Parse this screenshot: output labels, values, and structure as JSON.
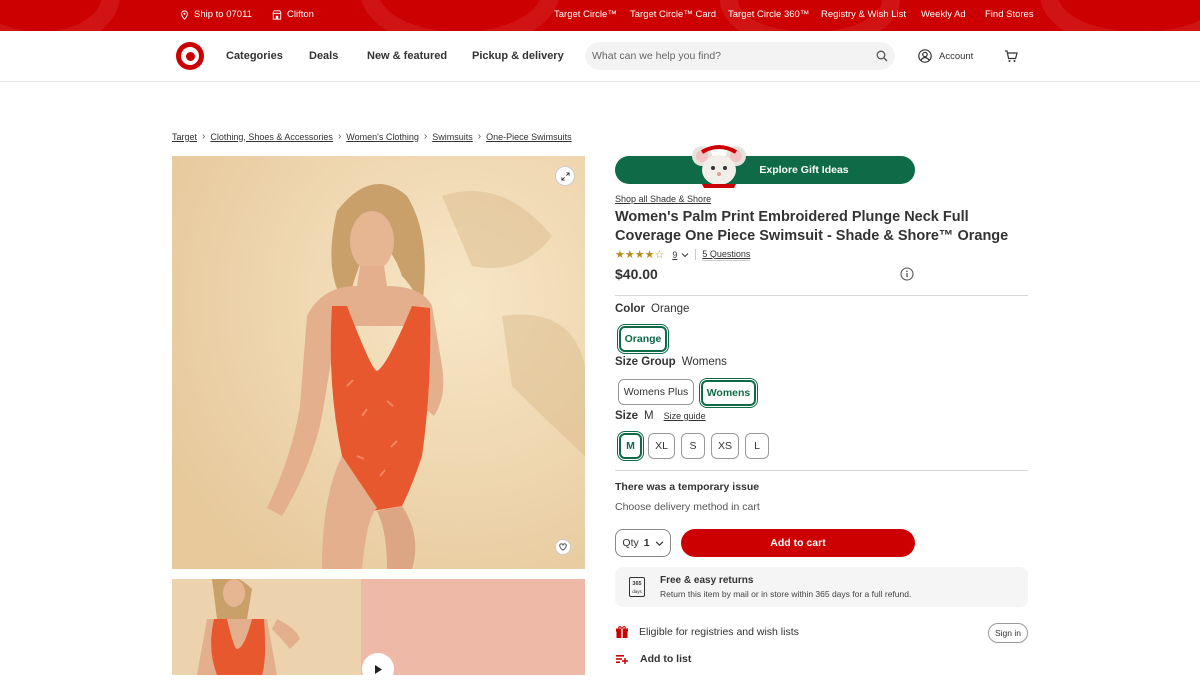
{
  "topbar": {
    "ship_to": "Ship to 07011",
    "store": "Clifton",
    "links": [
      "Target Circle™",
      "Target Circle™ Card",
      "Target Circle 360™",
      "Registry & Wish List",
      "Weekly Ad",
      "Find Stores"
    ]
  },
  "nav": {
    "categories": "Categories",
    "deals": "Deals",
    "new_featured": "New & featured",
    "pickup_delivery": "Pickup & delivery",
    "search_placeholder": "What can we help you find?",
    "account": "Account"
  },
  "breadcrumb": [
    "Target",
    "Clothing, Shoes & Accessories",
    "Women's Clothing",
    "Swimsuits",
    "One-Piece Swimsuits"
  ],
  "product": {
    "gift_banner": "Explore Gift Ideas",
    "shop_all": "Shop all Shade & Shore",
    "title": "Women's Palm Print Embroidered Plunge Neck Full Coverage One Piece Swimsuit - Shade & Shore™ Orange",
    "rating": 3.5,
    "rating_stars": "★★★★☆",
    "review_count": "9",
    "questions": "5 Questions",
    "price": "$40.00",
    "color_label": "Color",
    "color_value": "Orange",
    "color_options": [
      "Orange"
    ],
    "size_group_label": "Size Group",
    "size_group_value": "Womens",
    "size_group_options": [
      "Womens Plus",
      "Womens"
    ],
    "size_label": "Size",
    "size_value": "M",
    "size_guide": "Size guide",
    "size_options": [
      "M",
      "XL",
      "S",
      "XS",
      "L"
    ],
    "issue_title": "There was a temporary issue",
    "issue_desc": "Choose delivery method in cart",
    "qty_label": "Qty",
    "qty_value": "1",
    "add_to_cart": "Add to cart",
    "returns_title": "Free & easy returns",
    "returns_desc": "Return this item by mail or in store within 365 days for a full refund.",
    "returns_icon_text": "365",
    "returns_icon_sub": "days",
    "eligible": "Eligible for registries and wish lists",
    "sign_in": "Sign in",
    "add_to_list": "Add to list"
  },
  "colors": {
    "brand_red": "#cc0000",
    "green": "#0f6b47",
    "star_gold": "#b58d1f"
  }
}
